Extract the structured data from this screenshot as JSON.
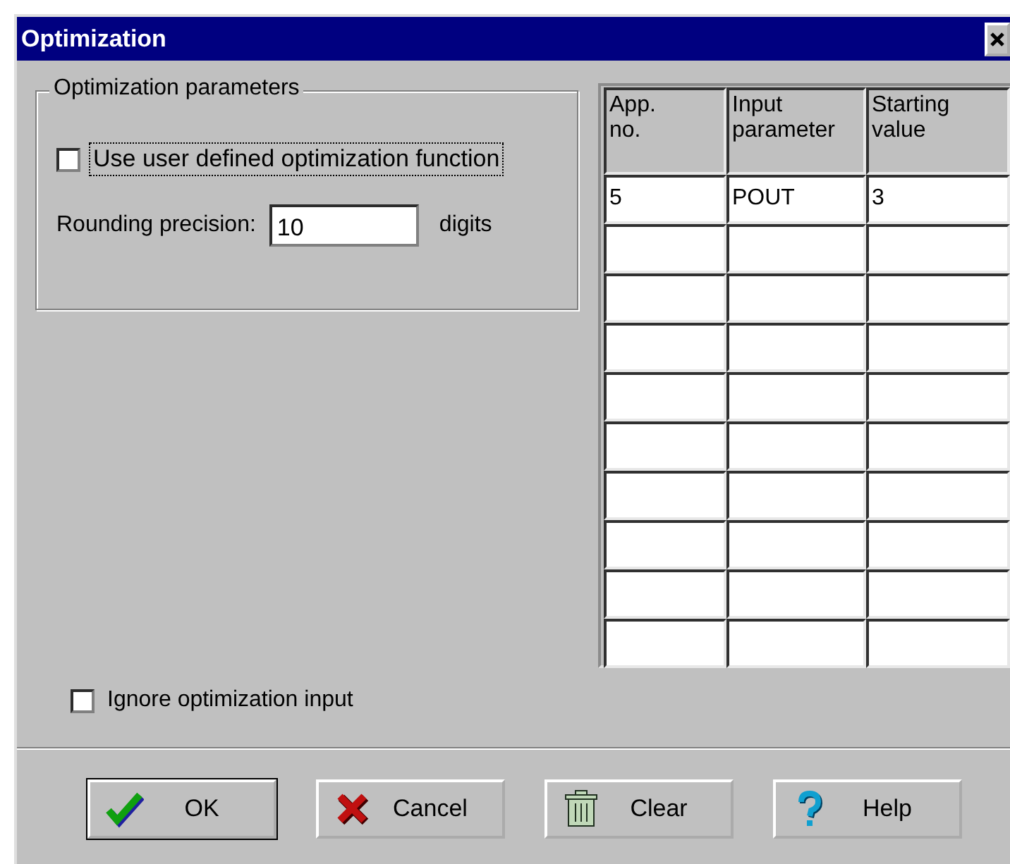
{
  "window": {
    "title": "Optimization"
  },
  "parameters_group": {
    "title": "Optimization parameters",
    "user_function": {
      "label": "Use user defined optimization function",
      "checked": false,
      "focused": true
    },
    "rounding": {
      "label": "Rounding precision:",
      "value": "10",
      "unit": "digits"
    }
  },
  "table": {
    "columns": [
      "App.\nno.",
      "Input\nparameter",
      "Starting\nvalue"
    ],
    "rows": [
      {
        "cells": [
          "5",
          "POUT",
          "3"
        ]
      }
    ]
  },
  "ignore_input": {
    "label": "Ignore optimization input",
    "checked": false
  },
  "buttons": [
    {
      "label": "OK",
      "kind": "check",
      "default": true
    },
    {
      "label": "Cancel",
      "kind": "cross",
      "default": false
    },
    {
      "label": "Clear",
      "kind": "trash",
      "default": false
    },
    {
      "label": "Help",
      "kind": "help",
      "default": false
    }
  ]
}
